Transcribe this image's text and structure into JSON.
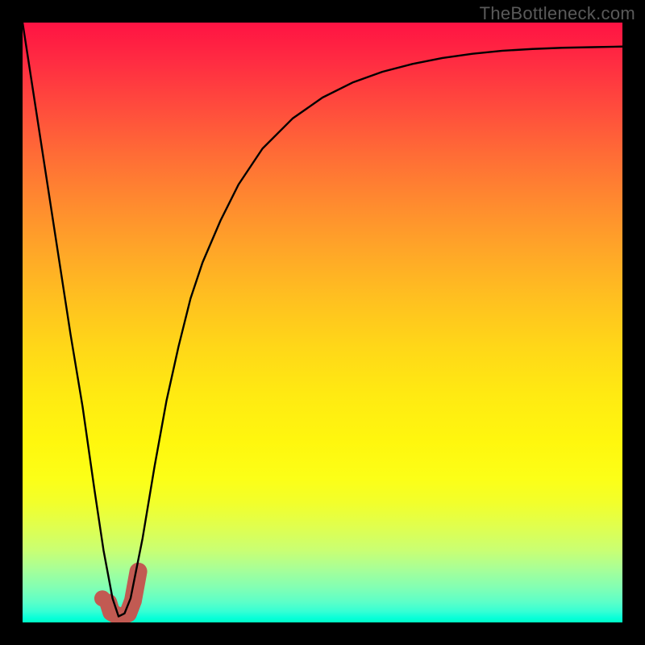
{
  "watermark": "TheBottleneck.com",
  "chart_data": {
    "type": "line",
    "title": "",
    "xlabel": "",
    "ylabel": "",
    "xlim": [
      0,
      100
    ],
    "ylim": [
      0,
      100
    ],
    "series": [
      {
        "name": "bottleneck-curve",
        "x": [
          0,
          2,
          4,
          6,
          8,
          10,
          12,
          13.5,
          15,
          16,
          17,
          18,
          20,
          22,
          24,
          26,
          28,
          30,
          33,
          36,
          40,
          45,
          50,
          55,
          60,
          65,
          70,
          75,
          80,
          85,
          90,
          95,
          100
        ],
        "y": [
          100,
          87,
          74,
          61,
          48,
          36,
          22,
          12,
          4,
          1,
          1.5,
          4,
          14,
          26,
          37,
          46,
          54,
          60,
          67,
          73,
          79,
          84,
          87.5,
          90,
          91.8,
          93.1,
          94.1,
          94.8,
          95.3,
          95.6,
          95.8,
          95.9,
          96
        ]
      }
    ],
    "marker": {
      "name": "J-marker",
      "dot": {
        "x": 13.3,
        "y": 4.0
      },
      "hook": [
        {
          "x": 14.3,
          "y": 3.3
        },
        {
          "x": 14.8,
          "y": 1.7
        },
        {
          "x": 16.2,
          "y": 0.9
        },
        {
          "x": 17.6,
          "y": 1.5
        },
        {
          "x": 18.4,
          "y": 3.6
        },
        {
          "x": 19.3,
          "y": 8.5
        }
      ]
    },
    "background_gradient": {
      "top": "#ff1343",
      "mid": "#ffe312",
      "bottom": "#00ffc3"
    }
  }
}
